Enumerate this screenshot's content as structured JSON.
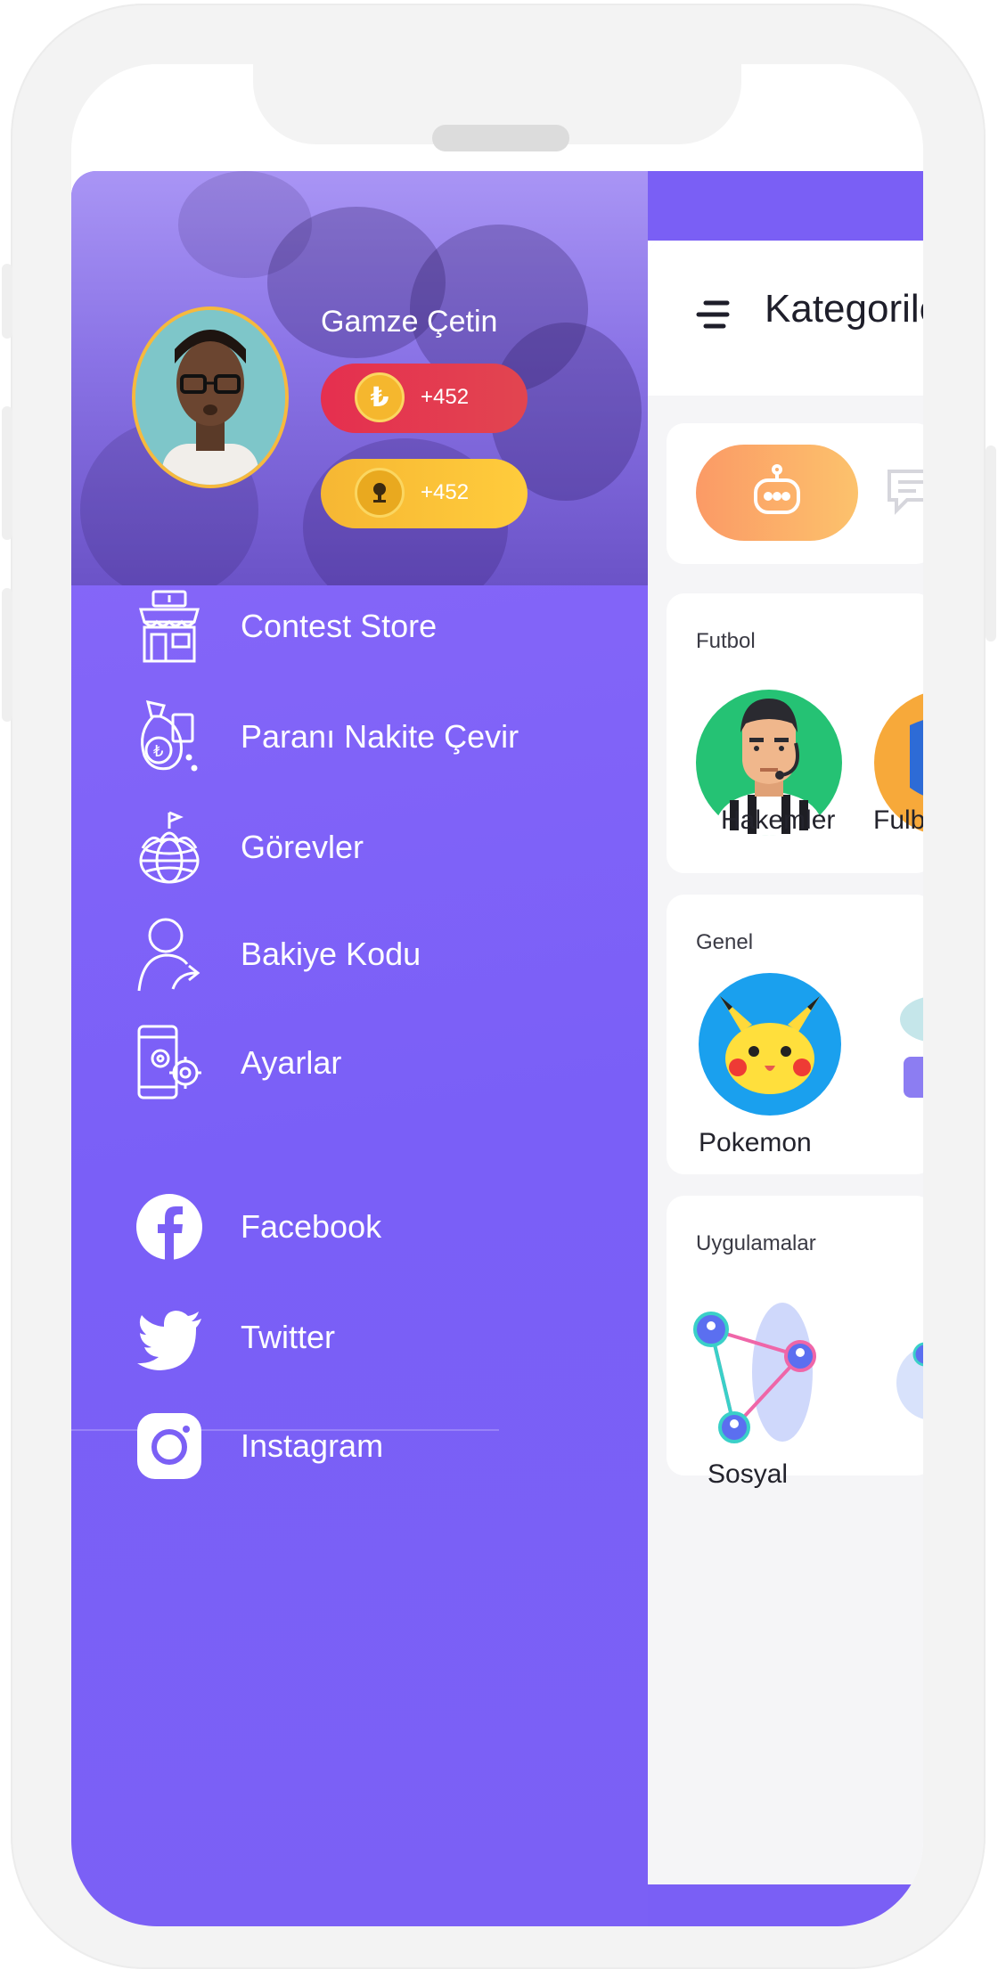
{
  "profile": {
    "name": "Gamze Çetin",
    "coins": "+452",
    "tokens": "+452"
  },
  "menu": [
    {
      "label": "Contest Store",
      "icon": "store-icon"
    },
    {
      "label": "Paranı Nakite Çevir",
      "icon": "money-bag-icon"
    },
    {
      "label": "Görevler",
      "icon": "globe-flag-icon"
    },
    {
      "label": "Bakiye Kodu",
      "icon": "user-share-icon"
    },
    {
      "label": "Ayarlar",
      "icon": "phone-settings-icon"
    }
  ],
  "social": [
    {
      "label": "Facebook",
      "icon": "facebook-icon"
    },
    {
      "label": "Twitter",
      "icon": "twitter-icon"
    },
    {
      "label": "Instagram",
      "icon": "instagram-icon"
    }
  ],
  "header": {
    "title": "Kategorile"
  },
  "categories": {
    "futbol": {
      "title": "Futbol",
      "items": [
        "Hakemler",
        "Fulbo"
      ]
    },
    "genel": {
      "title": "Genel",
      "items": [
        "Pokemon"
      ]
    },
    "uygulamalar": {
      "title": "Uygulamalar",
      "items": [
        "Sosyal"
      ]
    }
  },
  "colors": {
    "drawer": "#7b60f5",
    "coin_pill": "#e43a50",
    "token_pill": "#fbc23a",
    "chip_active": "#fbad69"
  }
}
